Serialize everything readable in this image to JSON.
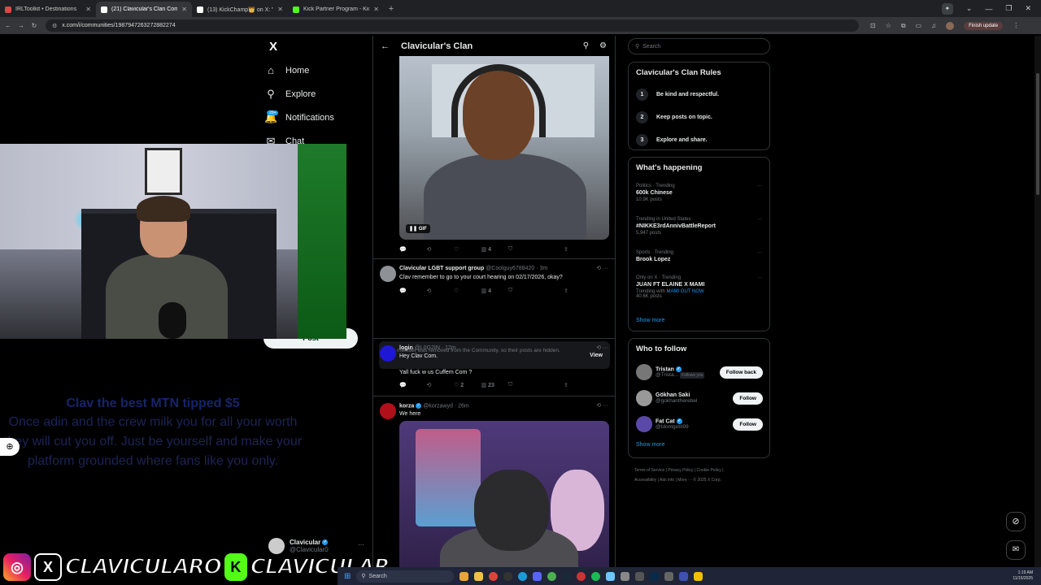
{
  "browser": {
    "tabs": [
      {
        "title": "IRLToolkit • Destinations",
        "color": "#e04646"
      },
      {
        "title": "(21) Clavicular's Clan Commun",
        "color": "#ffffff"
      },
      {
        "title": "(13) KickChamp👑 on X: \"Clavi",
        "color": "#ffffff"
      },
      {
        "title": "Kick Partner Program - Kick Da",
        "color": "#53fc18"
      }
    ],
    "new_tab": "+",
    "url": "x.com/i/communities/1987947263272882274",
    "finish_update": "Finish update"
  },
  "nav": {
    "logo": "X",
    "items": [
      {
        "label": "Home",
        "icon": "⌂"
      },
      {
        "label": "Explore",
        "icon": "⚲"
      },
      {
        "label": "Notifications",
        "icon": "🔔"
      },
      {
        "label": "Chat",
        "icon": "✉"
      }
    ],
    "notif_badge": "20+",
    "post_label": "Post"
  },
  "stream": {
    "tip_title": "Clav the best MTN tipped $5",
    "tip_body": "Once adin and the crew milk you for all your worth they will cut you off. Just be yourself and make your platform grounded where fans like you only.",
    "overlay_name1": "CLAVICULARO",
    "overlay_name2": "CLAVICULAR",
    "overlay_k": "K"
  },
  "profile": {
    "name": "Clavicular",
    "handle": "@Clavicular0"
  },
  "main": {
    "title": "Clavicular's Clan",
    "gif_label": "GIF",
    "gif_actions": {
      "likes": "",
      "views": "4"
    },
    "posts": [
      {
        "name": "Clavicular LGBT support group",
        "handle": "@Coolguy6788420",
        "time": "3m",
        "text": "Clav remember to go to your court hearing on 02/17/2026, okay?",
        "views": "4",
        "likes": ""
      },
      {
        "name": "login",
        "handle": "@L0G2IN",
        "time": "12m",
        "text": "Hey Clav Com.",
        "text2": "Yall fuck w us Cuffem Com ?",
        "likes": "2",
        "views": "23"
      },
      {
        "name": "korza",
        "handle": "@korzawyd",
        "time": "26m",
        "text": "We here"
      }
    ],
    "removed_text": "This member was removed from the Community, so their posts are hidden.",
    "removed_view": "View"
  },
  "right": {
    "search_placeholder": "Search",
    "rules_title": "Clavicular's Clan Rules",
    "rules": [
      {
        "n": "1",
        "text": "Be kind and respectful."
      },
      {
        "n": "2",
        "text": "Keep posts on topic."
      },
      {
        "n": "3",
        "text": "Explore and share."
      }
    ],
    "happening_title": "What's happening",
    "trends": [
      {
        "cat": "Politics · Trending",
        "name": "600k Chinese",
        "count": "10.9K posts"
      },
      {
        "cat": "Trending in United States",
        "name": "#NIKKE3rdAnnivBattleReport",
        "count": "5,947 posts"
      },
      {
        "cat": "Sports · Trending",
        "name": "Brook Lopez",
        "count": ""
      },
      {
        "cat": "Only on X · Trending",
        "name": "JUAN FT ELAINE X MAMI",
        "count": "40.6K posts",
        "with": "Trending with",
        "with_link": "MAMI OUT NOW"
      }
    ],
    "show_more": "Show more",
    "who_title": "Who to follow",
    "follow": [
      {
        "name": "Tristan",
        "handle": "@Trista...",
        "badge": "Follows you",
        "btn": "Follow back"
      },
      {
        "name": "Gökhan Saki",
        "handle": "@gokhantherebel",
        "btn": "Follow"
      },
      {
        "name": "Fat Cat",
        "handle": "@Idontgetit99",
        "btn": "Follow"
      }
    ],
    "footer": [
      "Terms of Service",
      "Privacy Policy",
      "Cookie Policy",
      "Accessibility",
      "Ads info",
      "More ···",
      "© 2025 X Corp."
    ]
  },
  "taskbar": {
    "search": "Search",
    "time": "1:19 AM",
    "date": "11/15/2025"
  }
}
